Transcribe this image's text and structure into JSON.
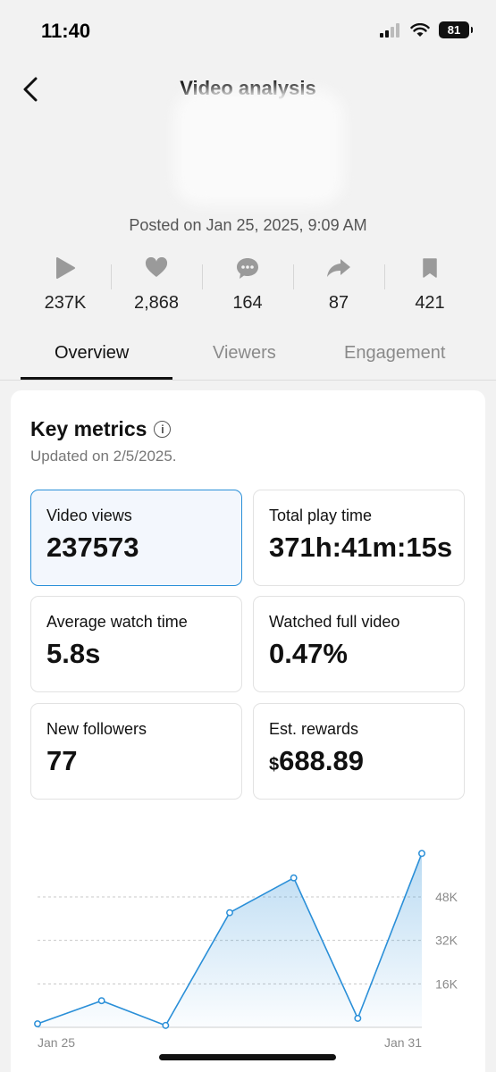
{
  "status_bar": {
    "time": "11:40",
    "battery": "81"
  },
  "nav": {
    "title": "Video analysis"
  },
  "post": {
    "posted": "Posted on Jan 25, 2025, 9:09 AM"
  },
  "stats": [
    {
      "icon": "play-icon",
      "value": "237K"
    },
    {
      "icon": "heart-icon",
      "value": "2,868"
    },
    {
      "icon": "comment-icon",
      "value": "164"
    },
    {
      "icon": "share-icon",
      "value": "87"
    },
    {
      "icon": "bookmark-icon",
      "value": "421"
    }
  ],
  "tabs": [
    {
      "label": "Overview",
      "active": true
    },
    {
      "label": "Viewers",
      "active": false
    },
    {
      "label": "Engagement",
      "active": false
    }
  ],
  "key_metrics": {
    "title": "Key metrics",
    "updated": "Updated on 2/5/2025.",
    "cards": [
      {
        "label": "Video views",
        "value": "237573"
      },
      {
        "label": "Total play time",
        "value": "371h:41m:15s"
      },
      {
        "label": "Average watch time",
        "value": "5.8s"
      },
      {
        "label": "Watched full video",
        "value": "0.47%"
      },
      {
        "label": "New followers",
        "value": "77"
      },
      {
        "label": "Est. rewards",
        "currency": "$",
        "value": "688.89"
      }
    ]
  },
  "colors": {
    "accent": "#2a8fd8",
    "text": "#111111",
    "muted": "#8a8a8a"
  },
  "chart_data": {
    "type": "area",
    "x": [
      "Jan 25",
      "Jan 26",
      "Jan 27",
      "Jan 28",
      "Jan 29",
      "Jan 30",
      "Jan 31"
    ],
    "x_tick_labels": [
      "Jan 25",
      "Jan 31"
    ],
    "values": [
      1300,
      9800,
      700,
      42200,
      55000,
      3300,
      64000
    ],
    "y_tick_labels": [
      "48K",
      "32K",
      "16K"
    ],
    "ylim": [
      0,
      72000
    ],
    "grid": true
  }
}
